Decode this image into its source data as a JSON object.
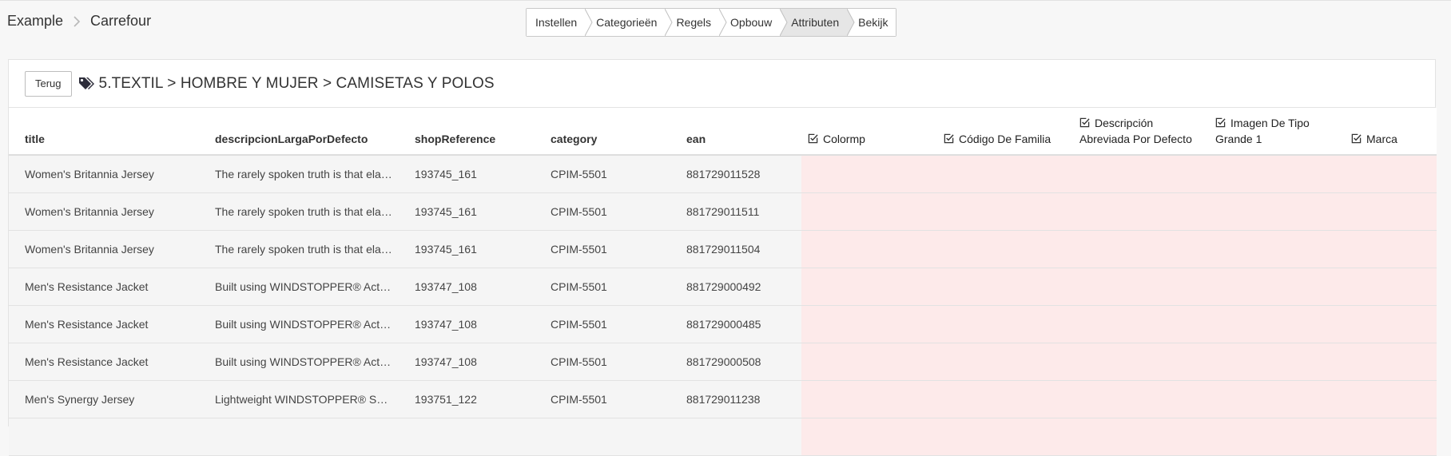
{
  "breadcrumb": {
    "items": [
      "Example",
      "Carrefour"
    ]
  },
  "steps": [
    {
      "label": "Instellen",
      "active": false
    },
    {
      "label": "Categorieën",
      "active": false
    },
    {
      "label": "Regels",
      "active": false
    },
    {
      "label": "Opbouw",
      "active": false
    },
    {
      "label": "Attributen",
      "active": true
    },
    {
      "label": "Bekijk",
      "active": false
    }
  ],
  "panel": {
    "back_label": "Terug",
    "category_path": "5.TEXTIL > HOMBRE Y MUJER > CAMISETAS Y POLOS",
    "icon": "tags-icon"
  },
  "table": {
    "columns": [
      {
        "label": "title",
        "type": "field"
      },
      {
        "label": "descripcionLargaPorDefecto",
        "type": "field"
      },
      {
        "label": "shopReference",
        "type": "field"
      },
      {
        "label": "category",
        "type": "field"
      },
      {
        "label": "ean",
        "type": "field"
      },
      {
        "label": "Colormp",
        "type": "attribute",
        "icon": "checkbox-edit-icon"
      },
      {
        "label": "Código De Familia",
        "type": "attribute",
        "icon": "checkbox-edit-icon"
      },
      {
        "label": "Descripción",
        "label2": "Abreviada Por Defecto",
        "type": "attribute",
        "icon": "checkbox-edit-icon"
      },
      {
        "label": "Imagen De Tipo",
        "label2": "Grande 1",
        "type": "attribute",
        "icon": "checkbox-edit-icon"
      },
      {
        "label": "Marca",
        "type": "attribute",
        "icon": "checkbox-edit-icon"
      }
    ],
    "rows": [
      [
        "Women's Britannia Jersey",
        "The rarely spoken truth is that ela…",
        "193745_161",
        "CPIM-5501",
        "881729011528"
      ],
      [
        "Women's Britannia Jersey",
        "The rarely spoken truth is that ela…",
        "193745_161",
        "CPIM-5501",
        "881729011511"
      ],
      [
        "Women's Britannia Jersey",
        "The rarely spoken truth is that ela…",
        "193745_161",
        "CPIM-5501",
        "881729011504"
      ],
      [
        "Men's Resistance Jacket",
        "Built using WINDSTOPPER® Acti…",
        "193747_108",
        "CPIM-5501",
        "881729000492"
      ],
      [
        "Men's Resistance Jacket",
        "Built using WINDSTOPPER® Acti…",
        "193747_108",
        "CPIM-5501",
        "881729000485"
      ],
      [
        "Men's Resistance Jacket",
        "Built using WINDSTOPPER® Acti…",
        "193747_108",
        "CPIM-5501",
        "881729000508"
      ],
      [
        "Men's Synergy Jersey",
        "Lightweight WINDSTOPPER® Sof…",
        "193751_122",
        "CPIM-5501",
        "881729011238"
      ],
      [
        "",
        "",
        "",
        "",
        ""
      ]
    ]
  },
  "colors": {
    "empty_attribute_cell": "#fdeaea",
    "active_step": "#e6e6e6",
    "row_background": "#f5f5f5"
  }
}
